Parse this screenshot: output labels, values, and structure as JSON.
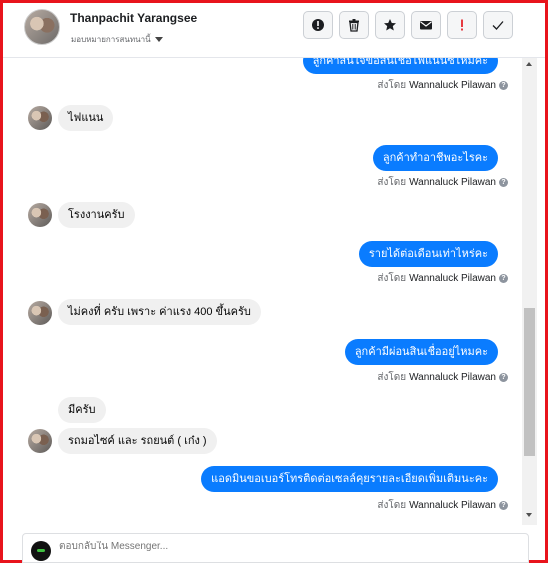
{
  "header": {
    "contact_name": "Thanpachit Yarangsee",
    "assign_label": "มอบหมายการสนทนานี้",
    "actions": [
      {
        "name": "spam-button",
        "icon": "alert-circle-icon"
      },
      {
        "name": "delete-button",
        "icon": "trash-icon"
      },
      {
        "name": "star-button",
        "icon": "star-icon"
      },
      {
        "name": "mark-unread-button",
        "icon": "envelope-icon"
      },
      {
        "name": "follow-up-button",
        "icon": "exclamation-icon"
      },
      {
        "name": "done-button",
        "icon": "check-icon"
      }
    ]
  },
  "messages": [
    {
      "dir": "out",
      "text": "ลูกค้าสนใจขอสินเชื่อไฟแนนซ์ไหมคะ",
      "sender_prefix": "ส่งโดย",
      "sender": "Wannaluck Pilawan"
    },
    {
      "dir": "in",
      "text": "ไฟแนน"
    },
    {
      "dir": "out",
      "text": "ลูกค้าทำอาชีพอะไรคะ",
      "sender_prefix": "ส่งโดย",
      "sender": "Wannaluck Pilawan"
    },
    {
      "dir": "in",
      "text": "โรงงานครับ"
    },
    {
      "dir": "out",
      "text": "รายได้ต่อเดือนเท่าไหร่คะ",
      "sender_prefix": "ส่งโดย",
      "sender": "Wannaluck Pilawan"
    },
    {
      "dir": "in",
      "text": "ไม่คงที่ ครับ เพราะ ค่าแรง 400 ขึ้นครับ"
    },
    {
      "dir": "out",
      "text": "ลูกค้ามีผ่อนสินเชื่ออยู่ไหมคะ",
      "sender_prefix": "ส่งโดย",
      "sender": "Wannaluck Pilawan"
    },
    {
      "dir": "in",
      "text": "มีครับ"
    },
    {
      "dir": "in",
      "text": "รถมอไซค์ และ รถยนต์ ( เก๋ง )"
    },
    {
      "dir": "out",
      "text": "แอดมินขอเบอร์โทรติดต่อเซลล์คุยรายละเอียดเพิ่มเติมนะคะ",
      "sender_prefix": "ส่งโดย",
      "sender": "Wannaluck Pilawan"
    }
  ],
  "composer": {
    "placeholder": "ตอบกลับใน Messenger..."
  },
  "colors": {
    "frame": "#e8141c",
    "outgoing_bubble": "#0a7cff",
    "incoming_bubble": "#f0f0f0"
  }
}
